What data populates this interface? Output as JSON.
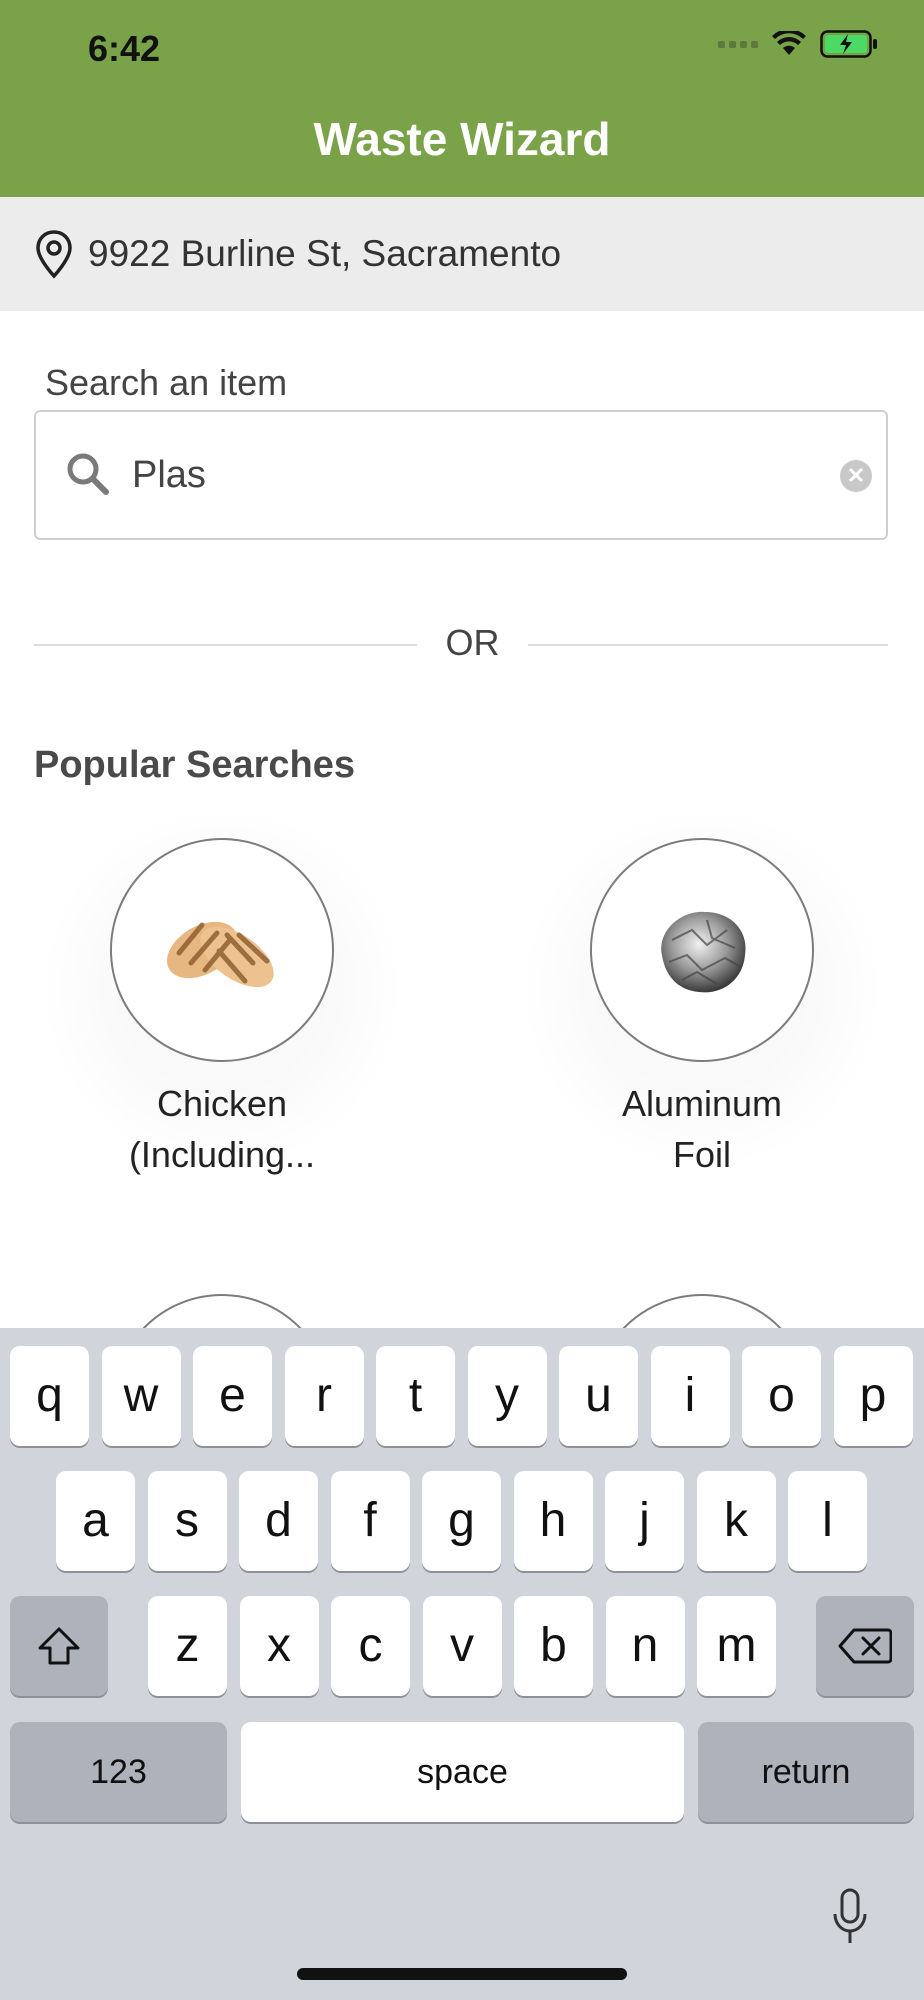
{
  "status_bar": {
    "time": "6:42"
  },
  "header": {
    "title": "Waste Wizard",
    "background_color": "#79a249"
  },
  "location": {
    "address": "9922 Burline St, Sacramento",
    "icon": "location-pin-icon"
  },
  "search": {
    "label": "Search an item",
    "value": "Plas",
    "icon": "search-icon",
    "clear_icon": "clear-icon"
  },
  "divider": {
    "text": "OR"
  },
  "popular": {
    "title": "Popular Searches",
    "items": [
      {
        "line1": "Chicken",
        "line2": "(Including...",
        "image": "grilled-chicken-image"
      },
      {
        "line1": "Aluminum",
        "line2": "Foil",
        "image": "aluminum-foil-image"
      }
    ]
  },
  "keyboard": {
    "row1": [
      "q",
      "w",
      "e",
      "r",
      "t",
      "y",
      "u",
      "i",
      "o",
      "p"
    ],
    "row2": [
      "a",
      "s",
      "d",
      "f",
      "g",
      "h",
      "j",
      "k",
      "l"
    ],
    "row3": [
      "z",
      "x",
      "c",
      "v",
      "b",
      "n",
      "m"
    ],
    "numbers_key": "123",
    "space_key": "space",
    "return_key": "return",
    "shift_icon": "shift-icon",
    "backspace_icon": "backspace-icon",
    "mic_icon": "microphone-icon"
  }
}
